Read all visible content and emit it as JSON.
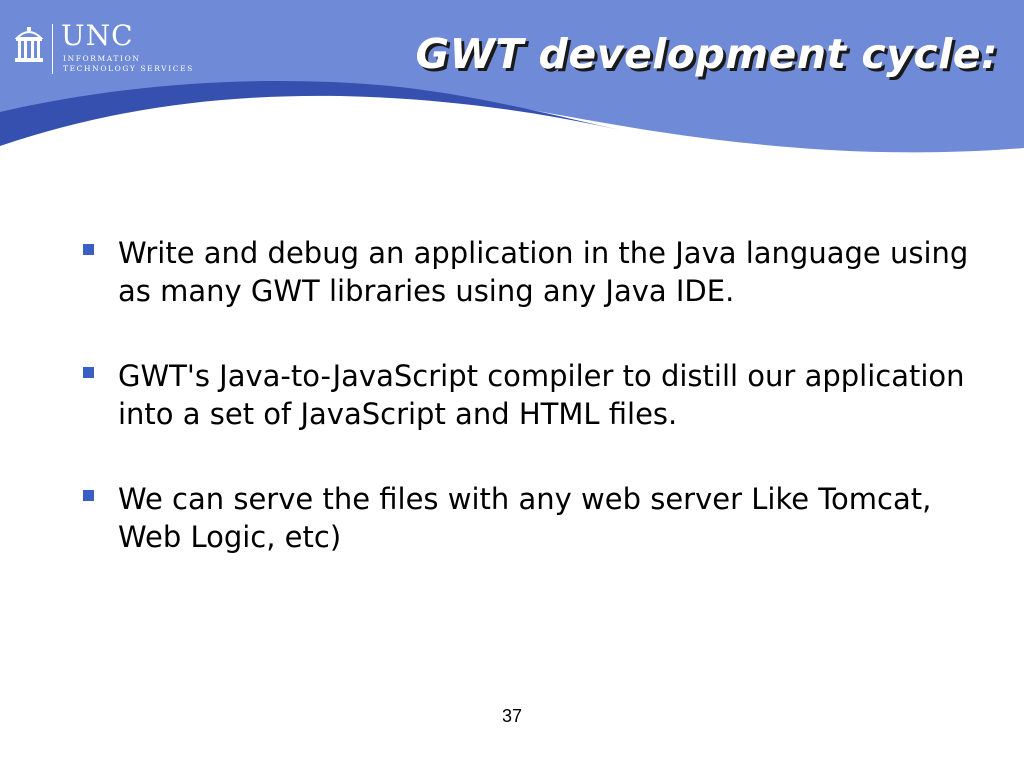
{
  "colors": {
    "header_light": "#6f8ad6",
    "header_dark": "#3550ae",
    "bullet": "#3b5ec4",
    "text": "#000000"
  },
  "logo": {
    "name": "UNC",
    "line1": "INFORMATION",
    "line2": "TECHNOLOGY SERVICES",
    "seal_icon": "old-well-icon"
  },
  "slide": {
    "title": "GWT development cycle:",
    "bullets": [
      "Write and debug an application in the Java language using as many GWT libraries using any Java IDE.",
      "GWT's Java-to-JavaScript compiler to distill our application into a set of JavaScript and HTML files.",
      "We can serve the files with any web server Like Tomcat, Web Logic, etc)"
    ],
    "page_number": "37"
  }
}
